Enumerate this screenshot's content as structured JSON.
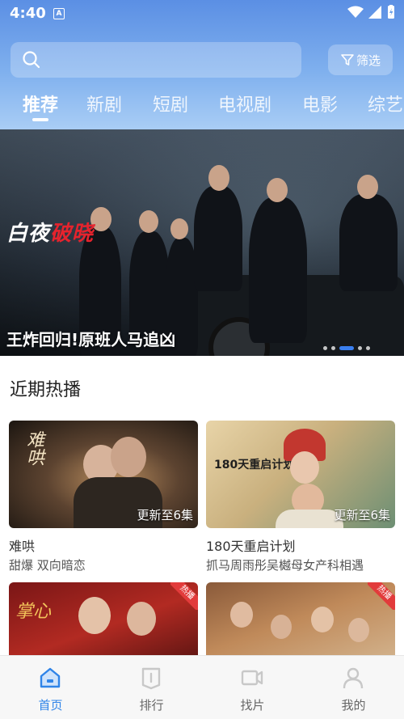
{
  "status_bar": {
    "time": "4:40",
    "badge": "A"
  },
  "search": {
    "placeholder": "",
    "filter_label": "筛选"
  },
  "tabs": [
    {
      "label": "推荐",
      "active": true
    },
    {
      "label": "新剧"
    },
    {
      "label": "短剧"
    },
    {
      "label": "电视剧"
    },
    {
      "label": "电影"
    },
    {
      "label": "综艺"
    }
  ],
  "banner": {
    "logo_text_white": "白夜",
    "logo_text_red": "破晓",
    "title": "王炸回归!原班人马追凶",
    "page_count": 5,
    "active_index": 3
  },
  "section": {
    "title": "近期热播"
  },
  "cards": [
    {
      "name": "难哄",
      "desc": "甜爆 双向暗恋",
      "update": "更新至6集",
      "thumb_text": "难哄"
    },
    {
      "name": "180天重启计划",
      "desc": "抓马周雨彤吴樾母女产科相遇",
      "update": "更新至6集",
      "thumb_text": "180天重启计划"
    },
    {
      "name": "",
      "desc": "",
      "update": "",
      "thumb_text": "掌心",
      "hot": "热播"
    },
    {
      "name": "",
      "desc": "",
      "update": "",
      "thumb_text": "",
      "hot": "热播"
    }
  ],
  "bottom_nav": [
    {
      "label": "首页",
      "active": true,
      "icon": "home-icon"
    },
    {
      "label": "排行",
      "icon": "ranking-icon"
    },
    {
      "label": "找片",
      "icon": "video-camera-icon"
    },
    {
      "label": "我的",
      "icon": "profile-icon"
    }
  ],
  "colors": {
    "accent": "#2f84e8",
    "header_top": "#5b8fe4",
    "hot_tag": "#e23b3b"
  }
}
